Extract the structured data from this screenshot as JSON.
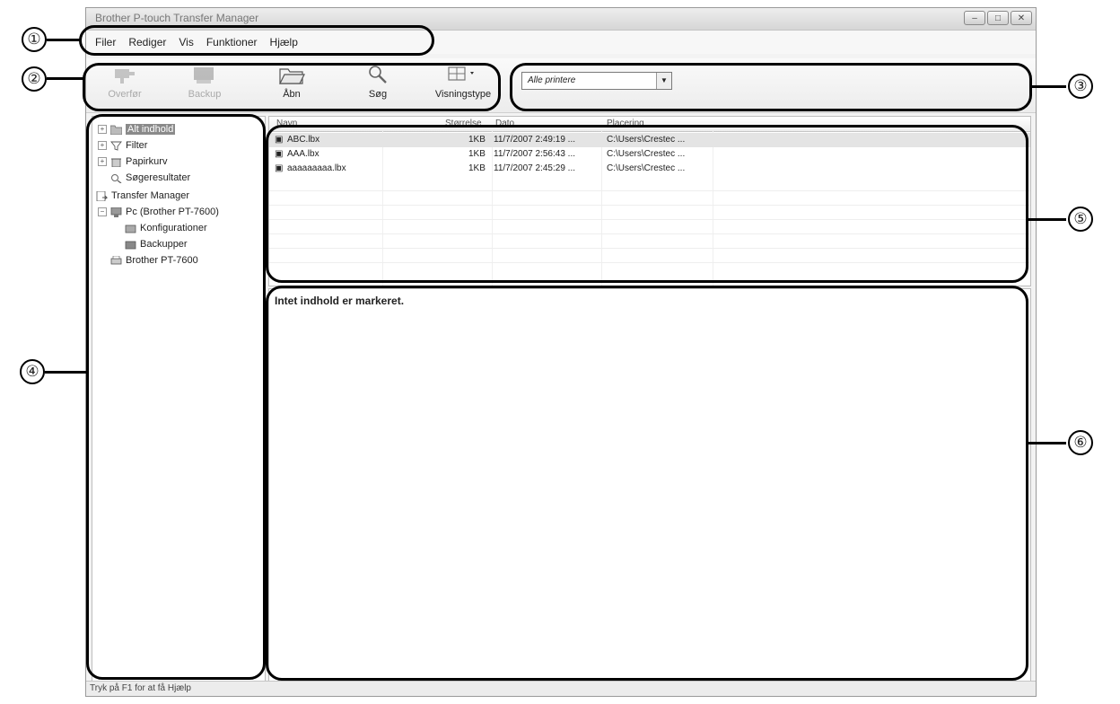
{
  "window": {
    "title": "Brother P-touch Transfer Manager",
    "controls": [
      "minimize",
      "maximize",
      "close"
    ]
  },
  "menu": [
    "Filer",
    "Rediger",
    "Vis",
    "Funktioner",
    "Hjælp"
  ],
  "toolbar": {
    "buttons": [
      {
        "label": "Overfør",
        "icon": "transfer-icon",
        "enabled": false
      },
      {
        "label": "Backup",
        "icon": "backup-icon",
        "enabled": false
      },
      {
        "label": "Åbn",
        "icon": "open-folder-icon",
        "enabled": true
      },
      {
        "label": "Søg",
        "icon": "search-icon",
        "enabled": true
      },
      {
        "label": "Visningstype",
        "icon": "view-type-icon",
        "enabled": true
      }
    ],
    "printer_select": "Alle printere"
  },
  "tree": {
    "items": [
      {
        "label": "Alt indhold",
        "selected": true
      },
      {
        "label": "Filter"
      },
      {
        "label": "Papirkurv"
      },
      {
        "label": "Søgeresultater"
      },
      {
        "label": "Transfer Manager"
      },
      {
        "label": "Pc (Brother PT-7600)"
      },
      {
        "label": "Konfigurationer"
      },
      {
        "label": "Backupper"
      },
      {
        "label": "Brother PT-7600"
      }
    ]
  },
  "list": {
    "columns": [
      "Navn",
      "Størrelse",
      "Dato",
      "Placering"
    ],
    "rows": [
      {
        "name": "ABC.lbx",
        "size": "1KB",
        "date": "11/7/2007 2:49:19 ...",
        "location": "C:\\Users\\Crestec ..."
      },
      {
        "name": "AAA.lbx",
        "size": "1KB",
        "date": "11/7/2007 2:56:43 ...",
        "location": "C:\\Users\\Crestec ..."
      },
      {
        "name": "aaaaaaaaa.lbx",
        "size": "1KB",
        "date": "11/7/2007 2:45:29 ...",
        "location": "C:\\Users\\Crestec ..."
      }
    ]
  },
  "preview": {
    "message": "Intet indhold er markeret."
  },
  "status": {
    "text": "Tryk på F1 for at få Hjælp"
  },
  "callouts": [
    "①",
    "②",
    "③",
    "④",
    "⑤",
    "⑥"
  ]
}
